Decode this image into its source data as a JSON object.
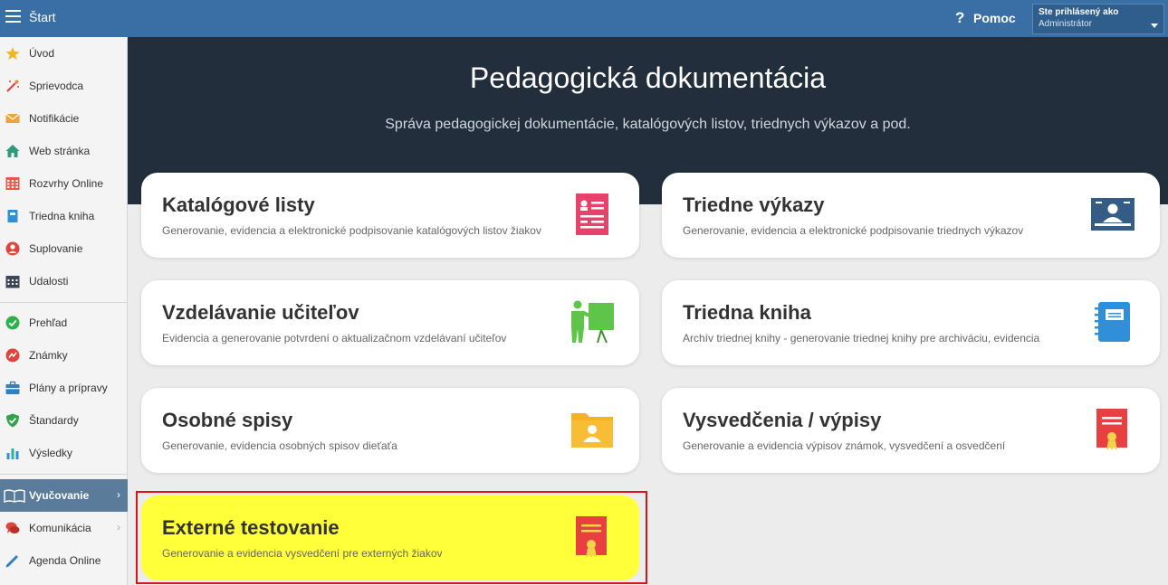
{
  "topbar": {
    "title": "Štart",
    "help_label": "Pomoc",
    "user_caption": "Ste prihlásený ako",
    "user_role": "Administrátor"
  },
  "sidebar": {
    "items": [
      {
        "label": "Úvod",
        "icon": "star-icon"
      },
      {
        "label": "Sprievodca",
        "icon": "magic-wand-icon"
      },
      {
        "label": "Notifikácie",
        "icon": "envelope-icon"
      },
      {
        "label": "Web stránka",
        "icon": "home-icon"
      },
      {
        "label": "Rozvrhy Online",
        "icon": "calendar-grid-icon"
      },
      {
        "label": "Triedna kniha",
        "icon": "book-icon"
      },
      {
        "label": "Suplovanie",
        "icon": "person-icon"
      },
      {
        "label": "Udalosti",
        "icon": "calendar-icon"
      },
      {
        "label": "Prehľad",
        "icon": "check-circle-icon"
      },
      {
        "label": "Známky",
        "icon": "grade-icon"
      },
      {
        "label": "Plány a prípravy",
        "icon": "briefcase-icon"
      },
      {
        "label": "Štandardy",
        "icon": "shield-check-icon"
      },
      {
        "label": "Výsledky",
        "icon": "bar-chart-icon"
      },
      {
        "label": "Vyučovanie",
        "icon": "open-book-icon"
      },
      {
        "label": "Komunikácia",
        "icon": "chat-icon"
      },
      {
        "label": "Agenda Online",
        "icon": "pencil-icon"
      }
    ]
  },
  "hero": {
    "title": "Pedagogická dokumentácia",
    "subtitle": "Správa pedagogickej dokumentácie, katalógových listov, triednych výkazov a pod."
  },
  "cards": [
    {
      "title": "Katalógové listy",
      "desc": "Generovanie, evidencia a elektronické podpisovanie katalógových listov žiakov",
      "icon": "catalog-list-icon"
    },
    {
      "title": "Triedne výkazy",
      "desc": "Generovanie, evidencia a elektronické podpisovanie triednych výkazov",
      "icon": "class-report-icon"
    },
    {
      "title": "Vzdelávanie učiteľov",
      "desc": "Evidencia a generovanie potvrdení o aktualizačnom vzdelávaní učiteľov",
      "icon": "teacher-board-icon"
    },
    {
      "title": "Triedna kniha",
      "desc": "Archív triednej knihy - generovanie triednej knihy pre archiváciu, evidencia",
      "icon": "notebook-icon"
    },
    {
      "title": "Osobné spisy",
      "desc": "Generovanie, evidencia osobných spisov dieťaťa",
      "icon": "personal-folder-icon"
    },
    {
      "title": "Vysvedčenia / výpisy",
      "desc": "Generovanie a evidencia výpisov známok, vysvedčení a osvedčení",
      "icon": "certificate-icon"
    },
    {
      "title": "Externé testovanie",
      "desc": "Generovanie a evidencia vysvedčení pre externých žiakov",
      "icon": "certificate-icon"
    }
  ],
  "colors": {
    "topbar": "#3a6fa5",
    "hero": "#222e3c",
    "highlight": "#ffff3a",
    "highlight_border": "#d8141a"
  }
}
